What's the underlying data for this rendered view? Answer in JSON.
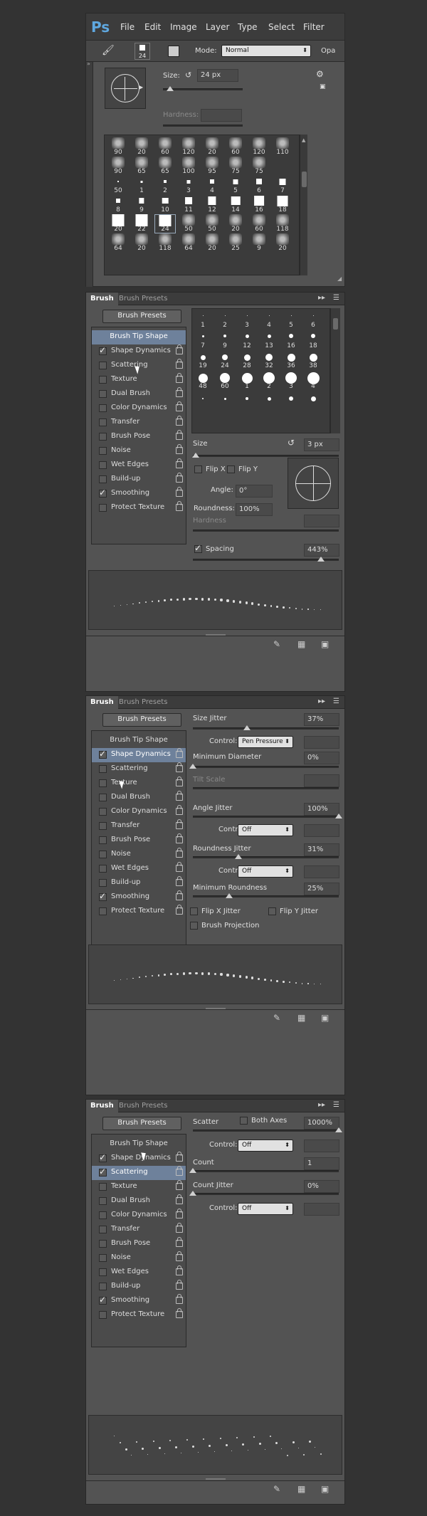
{
  "app": {
    "logo": "Ps",
    "menu": [
      "File",
      "Edit",
      "Image",
      "Layer",
      "Type",
      "Select",
      "Filter"
    ]
  },
  "options": {
    "brush_size": "24",
    "mode_label": "Mode:",
    "mode_value": "Normal",
    "opacity_label": "Opa"
  },
  "picker": {
    "size_label": "Size:",
    "size_value": "24 px",
    "hardness_label": "Hardness:",
    "grid": [
      [
        "90",
        "20",
        "60",
        "120",
        "20",
        "60",
        "120",
        "110"
      ],
      [
        "90",
        "65",
        "65",
        "100",
        "95",
        "75",
        "75"
      ],
      [
        "50",
        "1",
        "2",
        "3",
        "4",
        "5",
        "6",
        "7"
      ],
      [
        "8",
        "9",
        "10",
        "11",
        "12",
        "14",
        "16",
        "18"
      ],
      [
        "20",
        "22",
        "24",
        "50",
        "50",
        "20",
        "60",
        "118"
      ],
      [
        "64",
        "20",
        "118",
        "64",
        "20",
        "25",
        "9",
        "20"
      ]
    ]
  },
  "brush_tabs": {
    "brush": "Brush",
    "presets": "Brush Presets"
  },
  "presets_button": "Brush Presets",
  "list": {
    "head": "Brush Tip Shape",
    "items": [
      {
        "label": "Shape Dynamics"
      },
      {
        "label": "Scattering"
      },
      {
        "label": "Texture"
      },
      {
        "label": "Dual Brush"
      },
      {
        "label": "Color Dynamics"
      },
      {
        "label": "Transfer"
      },
      {
        "label": "Brush Pose"
      },
      {
        "label": "Noise"
      },
      {
        "label": "Wet Edges"
      },
      {
        "label": "Build-up"
      },
      {
        "label": "Smoothing"
      },
      {
        "label": "Protect Texture"
      }
    ]
  },
  "tip_panel": {
    "grid": [
      [
        "",
        "",
        "",
        "",
        "",
        "",
        "",
        ""
      ],
      [
        "1",
        "2",
        "3",
        "4",
        "5",
        "6"
      ],
      [
        "",
        "",
        "",
        "",
        "",
        ""
      ],
      [
        "7",
        "9",
        "12",
        "13",
        "16",
        "18"
      ],
      [
        "",
        "",
        "",
        "",
        "",
        ""
      ],
      [
        "19",
        "24",
        "28",
        "32",
        "36",
        "38"
      ],
      [
        "",
        "",
        "",
        "",
        "",
        ""
      ],
      [
        "48",
        "60",
        "1",
        "2",
        "3",
        "4"
      ]
    ],
    "size_label": "Size",
    "size_value": "3 px",
    "flipx": "Flip X",
    "flipy": "Flip Y",
    "angle_label": "Angle:",
    "angle_value": "0°",
    "roundness_label": "Roundness:",
    "roundness_value": "100%",
    "hardness_label": "Hardness",
    "spacing_label": "Spacing",
    "spacing_value": "443%",
    "spacing_level": 0.88,
    "size_level": 0.02
  },
  "dyn_panel": {
    "size_jitter_label": "Size Jitter",
    "size_jitter": "37%",
    "size_jitter_level": 0.37,
    "control_label": "Control:",
    "control1": "Pen Pressure",
    "min_diam_label": "Minimum Diameter",
    "min_diam": "0%",
    "tilt_label": "Tilt Scale",
    "angle_jitter_label": "Angle Jitter",
    "angle_jitter": "100%",
    "control2": "Off",
    "round_jitter_label": "Roundness Jitter",
    "round_jitter": "31%",
    "control3": "Off",
    "min_round_label": "Minimum Roundness",
    "min_round": "25%",
    "flipx_jitter": "Flip X Jitter",
    "flipy_jitter": "Flip Y Jitter",
    "projection": "Brush Projection"
  },
  "scat_panel": {
    "scatter_label": "Scatter",
    "both_axes": "Both Axes",
    "scatter_value": "1000%",
    "control_label": "Control:",
    "control1": "Off",
    "count_label": "Count",
    "count_value": "1",
    "count_jitter_label": "Count Jitter",
    "count_jitter": "0%",
    "control2": "Off"
  }
}
